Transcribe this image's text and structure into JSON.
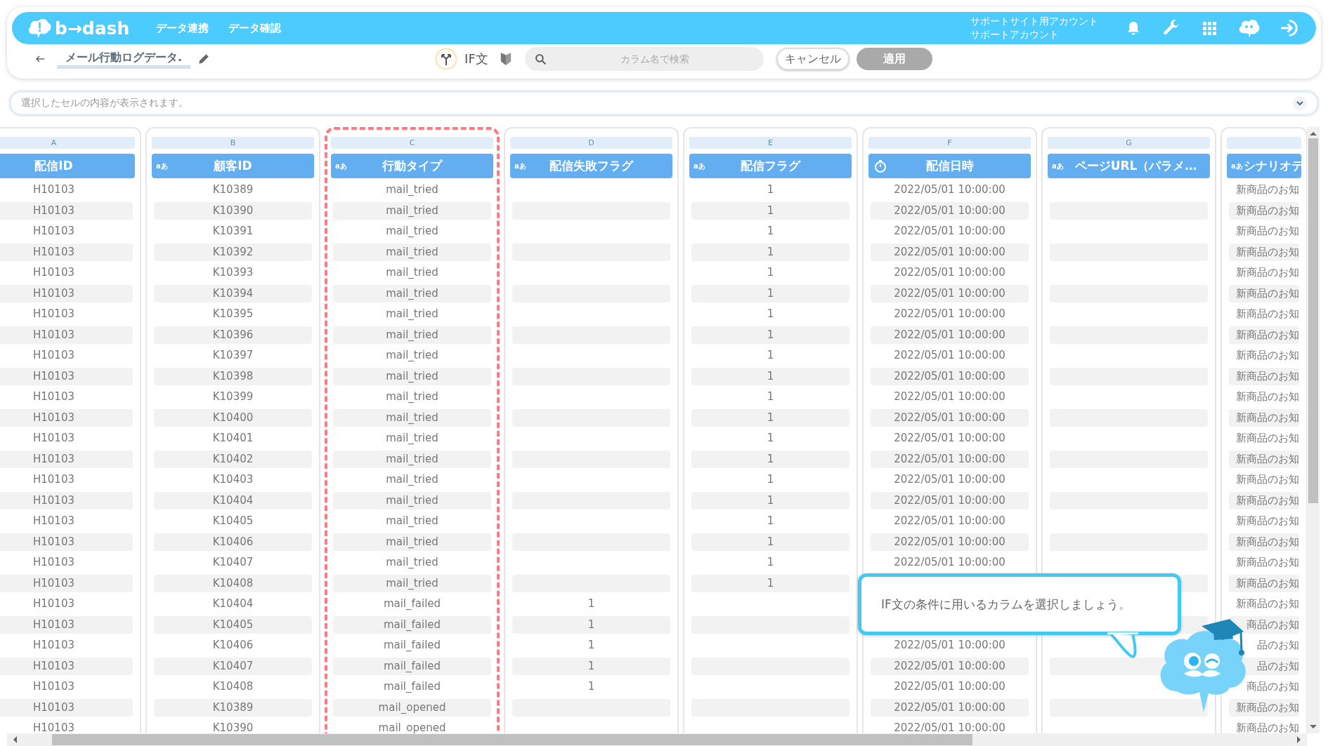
{
  "header": {
    "logo": "b→dash",
    "nav": [
      {
        "label": "データ連携"
      },
      {
        "label": "データ確認"
      }
    ],
    "account": [
      "サポートサイト用アカウント",
      "サポートアカウント"
    ]
  },
  "toolbar": {
    "title": "メール行動ログデータ.",
    "if_label": "IF文",
    "search": {
      "placeholder": "カラム名で検索"
    },
    "buttons": [
      {
        "label": "キャンセル",
        "disabled": false
      },
      {
        "label": "適用",
        "disabled": true
      }
    ]
  },
  "cell_viewer": {
    "placeholder": "選択したセルの内容が表示されます。"
  },
  "columns": [
    {
      "letter": "A",
      "title": "配信ID",
      "kind": "id",
      "highlighted": false,
      "cells": [
        "H10103",
        "H10103",
        "H10103",
        "H10103",
        "H10103",
        "H10103",
        "H10103",
        "H10103",
        "H10103",
        "H10103",
        "H10103",
        "H10103",
        "H10103",
        "H10103",
        "H10103",
        "H10103",
        "H10103",
        "H10103",
        "H10103",
        "H10103",
        "H10103",
        "H10103",
        "H10103",
        "H10103",
        "H10103",
        "H10103",
        "H10103"
      ]
    },
    {
      "letter": "B",
      "title": "顧客ID",
      "kind": "text",
      "badge": "aあ",
      "highlighted": false,
      "cells": [
        "K10389",
        "K10390",
        "K10391",
        "K10392",
        "K10393",
        "K10394",
        "K10395",
        "K10396",
        "K10397",
        "K10398",
        "K10399",
        "K10400",
        "K10401",
        "K10402",
        "K10403",
        "K10404",
        "K10405",
        "K10406",
        "K10407",
        "K10408",
        "K10404",
        "K10405",
        "K10406",
        "K10407",
        "K10408",
        "K10389",
        "K10390"
      ]
    },
    {
      "letter": "C",
      "title": "行動タイプ",
      "kind": "text",
      "badge": "aあ",
      "highlighted": true,
      "cells": [
        "mail_tried",
        "mail_tried",
        "mail_tried",
        "mail_tried",
        "mail_tried",
        "mail_tried",
        "mail_tried",
        "mail_tried",
        "mail_tried",
        "mail_tried",
        "mail_tried",
        "mail_tried",
        "mail_tried",
        "mail_tried",
        "mail_tried",
        "mail_tried",
        "mail_tried",
        "mail_tried",
        "mail_tried",
        "mail_tried",
        "mail_failed",
        "mail_failed",
        "mail_failed",
        "mail_failed",
        "mail_failed",
        "mail_opened",
        "mail_opened"
      ]
    },
    {
      "letter": "D",
      "title": "配信失敗フラグ",
      "kind": "text",
      "badge": "aあ",
      "highlighted": false,
      "cells": [
        null,
        null,
        null,
        null,
        null,
        null,
        null,
        null,
        null,
        null,
        null,
        null,
        null,
        null,
        null,
        null,
        null,
        null,
        null,
        null,
        "1",
        "1",
        "1",
        "1",
        "1",
        null,
        null
      ]
    },
    {
      "letter": "E",
      "title": "配信フラグ",
      "kind": "text",
      "badge": "aあ",
      "highlighted": false,
      "cells": [
        "1",
        "1",
        "1",
        "1",
        "1",
        "1",
        "1",
        "1",
        "1",
        "1",
        "1",
        "1",
        "1",
        "1",
        "1",
        "1",
        "1",
        "1",
        "1",
        "1",
        null,
        null,
        null,
        null,
        null,
        null,
        null
      ]
    },
    {
      "letter": "F",
      "title": "配信日時",
      "kind": "datetime",
      "highlighted": false,
      "cells": [
        "2022/05/01 10:00:00",
        "2022/05/01 10:00:00",
        "2022/05/01 10:00:00",
        "2022/05/01 10:00:00",
        "2022/05/01 10:00:00",
        "2022/05/01 10:00:00",
        "2022/05/01 10:00:00",
        "2022/05/01 10:00:00",
        "2022/05/01 10:00:00",
        "2022/05/01 10:00:00",
        "2022/05/01 10:00:00",
        "2022/05/01 10:00:00",
        "2022/05/01 10:00:00",
        "2022/05/01 10:00:00",
        "2022/05/01 10:00:00",
        "2022/05/01 10:00:00",
        "2022/05/01 10:00:00",
        "2022/05/01 10:00:00",
        "2022/05/01 10:00:00",
        null,
        null,
        null,
        "2022/05/01 10:00:00",
        "2022/05/01 10:00:00",
        "2022/05/01 10:00:00",
        "2022/05/01 10:00:00",
        "2022/05/01 10:00:00"
      ]
    },
    {
      "letter": "G",
      "title": "ページURL（パラメ…",
      "kind": "text",
      "badge": "aあ",
      "highlighted": false,
      "cells": [
        null,
        null,
        null,
        null,
        null,
        null,
        null,
        null,
        null,
        null,
        null,
        null,
        null,
        null,
        null,
        null,
        null,
        null,
        null,
        null,
        null,
        null,
        null,
        null,
        null,
        null,
        null
      ]
    },
    {
      "title": "シナリオテ",
      "kind": "text",
      "badge": "aあ",
      "highlighted": false,
      "cells": [
        "新商品のお知",
        "新商品のお知",
        "新商品のお知",
        "新商品のお知",
        "新商品のお知",
        "新商品のお知",
        "新商品のお知",
        "新商品のお知",
        "新商品のお知",
        "新商品のお知",
        "新商品のお知",
        "新商品のお知",
        "新商品のお知",
        "新商品のお知",
        "新商品のお知",
        "新商品のお知",
        "新商品のお知",
        "新商品のお知",
        "新商品のお知",
        "新商品のお知",
        "新商品のお知",
        "商品のお知",
        "品のお知",
        "品のお知",
        "商品のお知",
        "新商品のお知",
        "新商品のお知"
      ]
    }
  ],
  "guide": {
    "message": "IF文の条件に用いるカラムを選択しましょう。"
  }
}
